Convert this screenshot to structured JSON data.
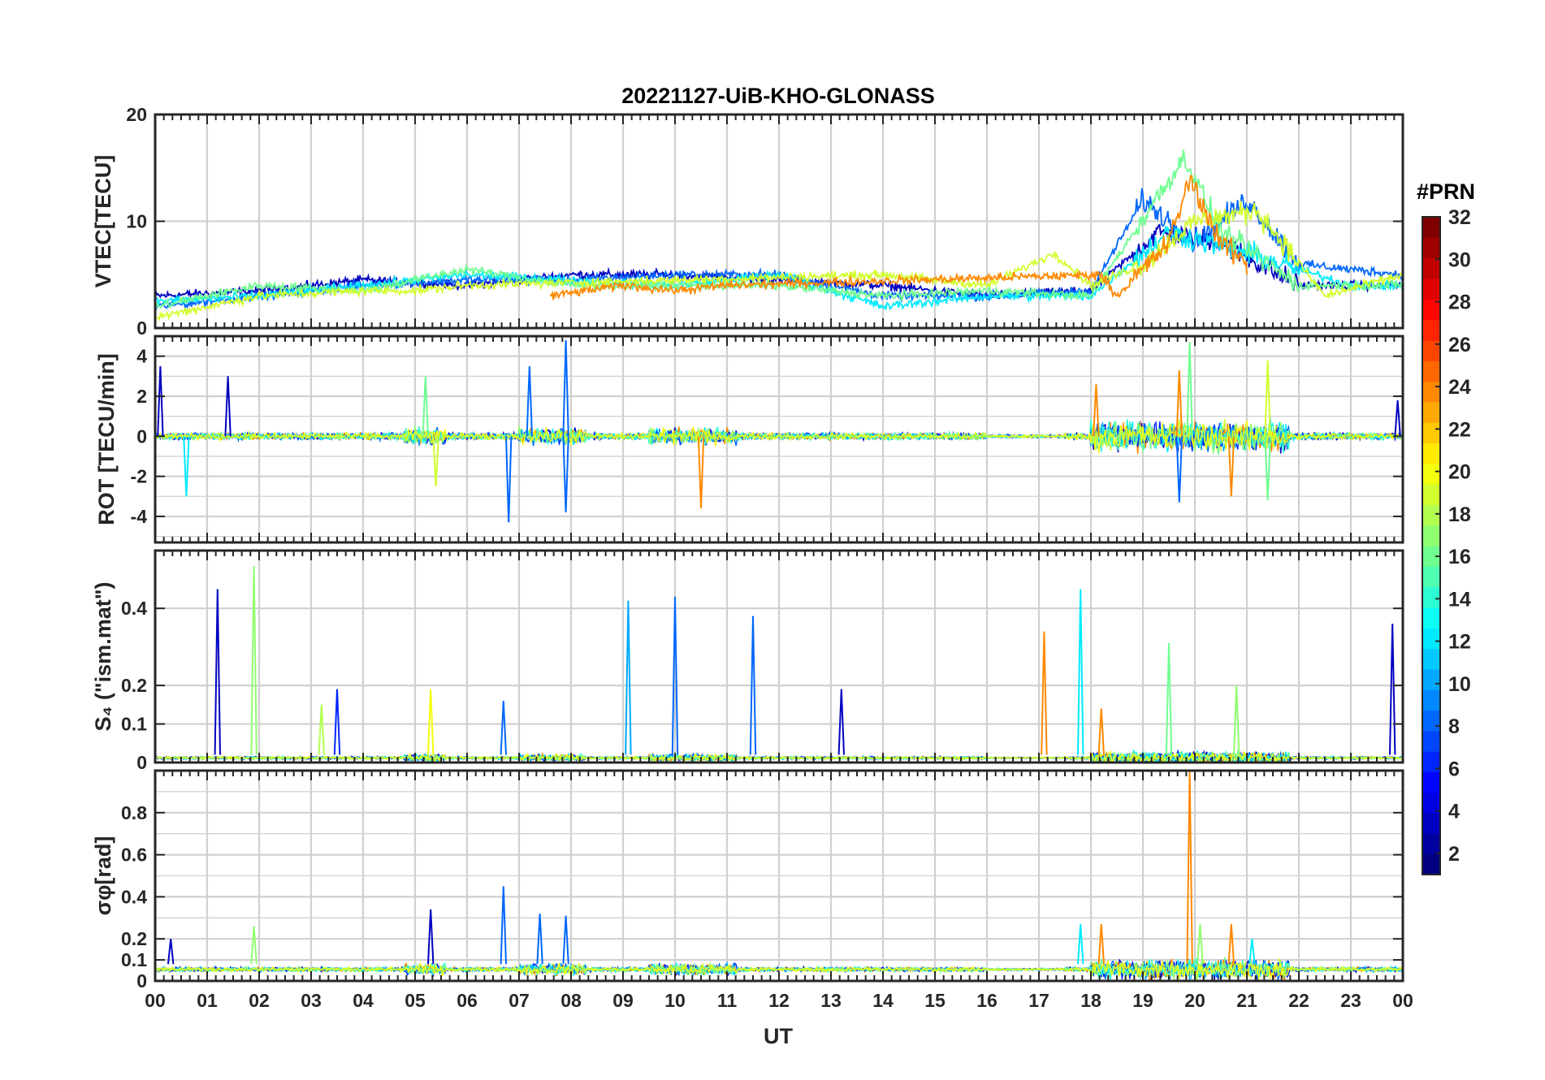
{
  "chart_data": [
    {
      "type": "line",
      "panel": "vtec",
      "title": "20221127-UiB-KHO-GLONASS",
      "ylabel": "VTEC[TECU]",
      "ylim": [
        0,
        20
      ],
      "yticks": [
        0,
        10,
        20
      ],
      "ytick_labels": [
        "0",
        "10",
        "20"
      ],
      "xlim": [
        0,
        24
      ],
      "grid": true,
      "series": [
        {
          "prn": 3,
          "values": [
            [
              0,
              3
            ],
            [
              2,
              3.5
            ],
            [
              4,
              4.5
            ],
            [
              6,
              4
            ],
            [
              8,
              5
            ],
            [
              10,
              5
            ],
            [
              12,
              4.5
            ],
            [
              14,
              4
            ],
            [
              16,
              3
            ],
            [
              18,
              3.5
            ],
            [
              19.3,
              9
            ],
            [
              20.5,
              8
            ],
            [
              22,
              4
            ],
            [
              24,
              4
            ]
          ]
        },
        {
          "prn": 8,
          "values": [
            [
              0,
              2
            ],
            [
              2,
              3
            ],
            [
              4,
              4
            ],
            [
              6,
              4.5
            ],
            [
              8,
              4.5
            ],
            [
              10,
              5
            ],
            [
              12,
              5
            ],
            [
              14,
              3
            ],
            [
              16,
              3
            ],
            [
              18,
              3.5
            ],
            [
              19,
              12
            ],
            [
              20,
              8
            ],
            [
              21,
              12
            ],
            [
              22,
              6
            ],
            [
              24,
              5
            ]
          ]
        },
        {
          "prn": 12,
          "values": [
            [
              0,
              2.5
            ],
            [
              2,
              3
            ],
            [
              4,
              4
            ],
            [
              6,
              5
            ],
            [
              8,
              4.5
            ],
            [
              10,
              4
            ],
            [
              12,
              5
            ],
            [
              14,
              2
            ],
            [
              16,
              3
            ],
            [
              18,
              3
            ],
            [
              19.5,
              9
            ],
            [
              21,
              7
            ],
            [
              23,
              4
            ],
            [
              24,
              4
            ]
          ]
        },
        {
          "prn": 16,
          "values": [
            [
              0,
              2
            ],
            [
              2,
              4
            ],
            [
              4,
              3.5
            ],
            [
              6,
              5.5
            ],
            [
              8,
              4
            ],
            [
              10,
              4
            ],
            [
              12,
              4
            ],
            [
              14,
              3
            ],
            [
              16,
              3.5
            ],
            [
              18,
              3
            ],
            [
              19.8,
              16
            ],
            [
              20.5,
              9
            ],
            [
              22,
              4
            ],
            [
              24,
              4
            ]
          ]
        },
        {
          "prn": 19,
          "values": [
            [
              0,
              1
            ],
            [
              2,
              3
            ],
            [
              4,
              3.5
            ],
            [
              5,
              3.5
            ],
            [
              6,
              4
            ],
            [
              14,
              5
            ],
            [
              16,
              4
            ],
            [
              17.3,
              7
            ],
            [
              18,
              4
            ],
            [
              19,
              6
            ],
            [
              20,
              10
            ],
            [
              21.2,
              11
            ],
            [
              22.5,
              3
            ],
            [
              24,
              5
            ]
          ]
        },
        {
          "prn": 24,
          "values": [
            [
              7.6,
              3
            ],
            [
              9,
              4
            ],
            [
              10,
              3.5
            ],
            [
              11,
              4
            ],
            [
              18.2,
              5
            ],
            [
              18.5,
              3
            ],
            [
              19.5,
              8
            ],
            [
              19.9,
              14
            ],
            [
              20.5,
              8
            ],
            [
              21,
              6
            ]
          ]
        }
      ]
    },
    {
      "type": "line",
      "panel": "rot",
      "ylabel": "ROT [TECU/min]",
      "ylim": [
        -5.3,
        5
      ],
      "yticks": [
        -4,
        -2,
        0,
        2,
        4
      ],
      "ytick_labels": [
        "-4",
        "-2",
        "0",
        "2",
        "4"
      ],
      "xlim": [
        0,
        24
      ],
      "grid": true,
      "spikes": [
        {
          "x": 0.1,
          "y": 3.5,
          "prn": 3
        },
        {
          "x": 0.6,
          "y": -3,
          "prn": 12
        },
        {
          "x": 1.4,
          "y": 3,
          "prn": 3
        },
        {
          "x": 5.2,
          "y": 3,
          "prn": 16
        },
        {
          "x": 5.4,
          "y": -2.5,
          "prn": 19
        },
        {
          "x": 6.8,
          "y": -4.3,
          "prn": 8
        },
        {
          "x": 7.2,
          "y": 3.5,
          "prn": 8
        },
        {
          "x": 7.9,
          "y": 4.8,
          "prn": 8
        },
        {
          "x": 7.9,
          "y": -3.8,
          "prn": 8
        },
        {
          "x": 10.5,
          "y": -3.6,
          "prn": 24
        },
        {
          "x": 18.1,
          "y": 2.6,
          "prn": 24
        },
        {
          "x": 19.7,
          "y": 3.3,
          "prn": 24
        },
        {
          "x": 19.9,
          "y": 4.7,
          "prn": 16
        },
        {
          "x": 19.7,
          "y": -3.3,
          "prn": 8
        },
        {
          "x": 20.7,
          "y": -3,
          "prn": 24
        },
        {
          "x": 21.4,
          "y": 3.8,
          "prn": 19
        },
        {
          "x": 21.4,
          "y": -3.2,
          "prn": 16
        },
        {
          "x": 23.9,
          "y": 1.8,
          "prn": 3
        }
      ]
    },
    {
      "type": "line",
      "panel": "s4",
      "ylabel": "S₄ (\"ism.mat\")",
      "ylim": [
        0,
        0.55
      ],
      "yticks": [
        0,
        0.1,
        0.2,
        0.4
      ],
      "ytick_labels": [
        "0",
        "0.1",
        "0.2",
        "0.4"
      ],
      "xlim": [
        0,
        24
      ],
      "grid": true,
      "spikes": [
        {
          "x": 1.2,
          "y": 0.45,
          "prn": 3
        },
        {
          "x": 1.9,
          "y": 0.51,
          "prn": 17
        },
        {
          "x": 3.2,
          "y": 0.15,
          "prn": 18
        },
        {
          "x": 3.5,
          "y": 0.19,
          "prn": 6
        },
        {
          "x": 5.3,
          "y": 0.19,
          "prn": 20
        },
        {
          "x": 6.7,
          "y": 0.16,
          "prn": 8
        },
        {
          "x": 9.1,
          "y": 0.42,
          "prn": 10
        },
        {
          "x": 10.0,
          "y": 0.43,
          "prn": 8
        },
        {
          "x": 11.5,
          "y": 0.38,
          "prn": 8
        },
        {
          "x": 13.2,
          "y": 0.19,
          "prn": 3
        },
        {
          "x": 17.1,
          "y": 0.34,
          "prn": 24
        },
        {
          "x": 17.8,
          "y": 0.45,
          "prn": 12
        },
        {
          "x": 18.2,
          "y": 0.14,
          "prn": 24
        },
        {
          "x": 19.5,
          "y": 0.31,
          "prn": 16
        },
        {
          "x": 20.8,
          "y": 0.2,
          "prn": 17
        },
        {
          "x": 23.8,
          "y": 0.36,
          "prn": 3
        }
      ]
    },
    {
      "type": "line",
      "panel": "sigma_phi",
      "ylabel": "σφ[rad]",
      "ylim": [
        0,
        1
      ],
      "yticks": [
        0,
        0.1,
        0.2,
        0.4,
        0.6,
        0.8
      ],
      "ytick_labels": [
        "0",
        "0.1",
        "0.2",
        "0.4",
        "0.6",
        "0.8"
      ],
      "xlim": [
        0,
        24
      ],
      "grid": true,
      "spikes": [
        {
          "x": 0.3,
          "y": 0.2,
          "prn": 3
        },
        {
          "x": 1.9,
          "y": 0.26,
          "prn": 17
        },
        {
          "x": 5.3,
          "y": 0.34,
          "prn": 3
        },
        {
          "x": 6.7,
          "y": 0.45,
          "prn": 8
        },
        {
          "x": 7.4,
          "y": 0.32,
          "prn": 8
        },
        {
          "x": 7.9,
          "y": 0.31,
          "prn": 8
        },
        {
          "x": 17.8,
          "y": 0.27,
          "prn": 12
        },
        {
          "x": 18.2,
          "y": 0.27,
          "prn": 24
        },
        {
          "x": 19.9,
          "y": 1.0,
          "prn": 24
        },
        {
          "x": 20.1,
          "y": 0.27,
          "prn": 17
        },
        {
          "x": 20.7,
          "y": 0.27,
          "prn": 24
        },
        {
          "x": 21.1,
          "y": 0.2,
          "prn": 12
        }
      ]
    }
  ],
  "xaxis": {
    "label": "UT",
    "ticks": [
      "00",
      "01",
      "02",
      "03",
      "04",
      "05",
      "06",
      "07",
      "08",
      "09",
      "10",
      "11",
      "12",
      "13",
      "14",
      "15",
      "16",
      "17",
      "18",
      "19",
      "20",
      "21",
      "22",
      "23",
      "00"
    ]
  },
  "colorbar": {
    "label": "#PRN",
    "range": [
      1,
      32
    ],
    "ticks": [
      "2",
      "4",
      "6",
      "8",
      "10",
      "12",
      "14",
      "16",
      "18",
      "20",
      "22",
      "24",
      "26",
      "28",
      "30",
      "32"
    ],
    "colormap": "jet"
  }
}
